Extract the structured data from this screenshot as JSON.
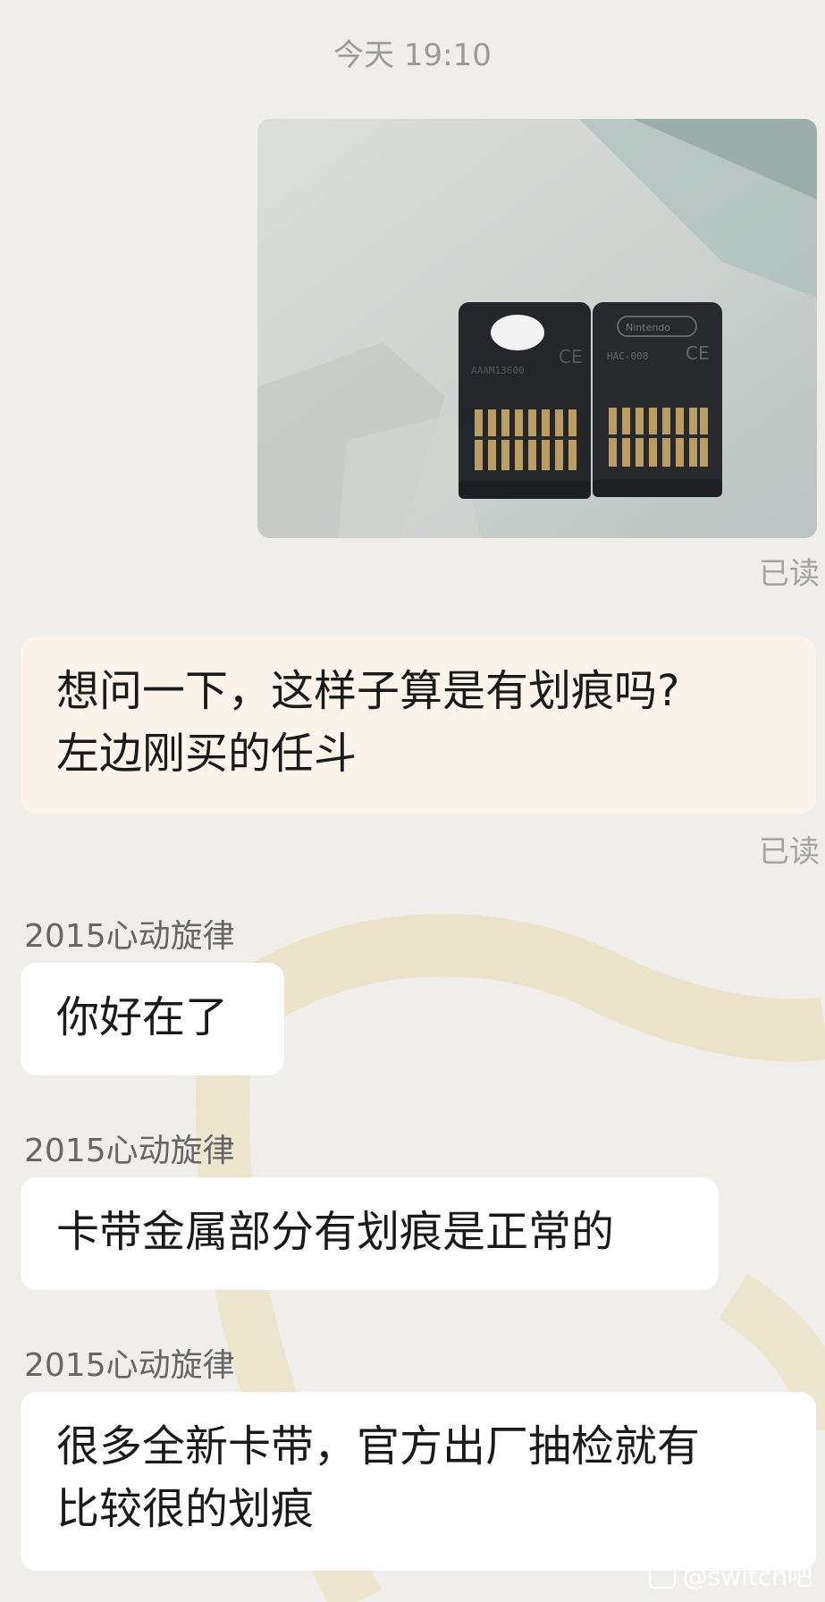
{
  "chat": {
    "timestamp": "今天 19:10",
    "read_label": "已读",
    "messages": [
      {
        "type": "image",
        "from": "me"
      },
      {
        "type": "text",
        "from": "me",
        "text_line1": "想问一下，这样子算是有划痕吗?",
        "text_line2": "左边刚买的任斗"
      },
      {
        "type": "text",
        "from": "other",
        "sender": "2015心动旋律",
        "text": "你好在了"
      },
      {
        "type": "text",
        "from": "other",
        "sender": "2015心动旋律",
        "text": "卡带金属部分有划痕是正常的"
      },
      {
        "type": "text",
        "from": "other",
        "sender": "2015心动旋律",
        "text_line1": "很多全新卡带，官方出厂抽检就有",
        "text_line2": "比较很的划痕"
      }
    ]
  },
  "photo": {
    "left_card_label": "AAAM13600",
    "right_card_brand": "Nintendo",
    "right_card_label": "HAC-008",
    "ce_mark": "CE"
  },
  "watermark": {
    "text": "@switch吧"
  },
  "colors": {
    "background": "#efeeeb",
    "my_bubble": "#fbf4ea",
    "their_bubble": "#ffffff",
    "decor": "#e6d6a4"
  }
}
